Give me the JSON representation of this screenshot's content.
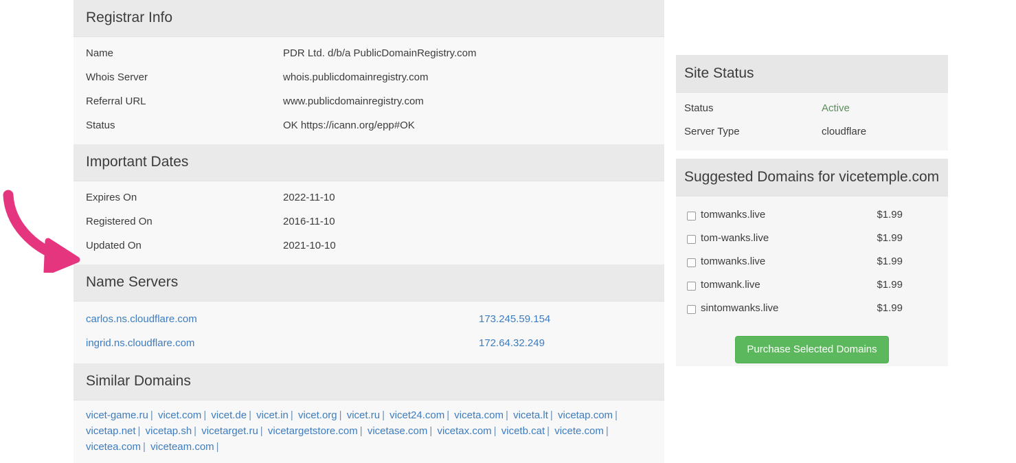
{
  "main": {
    "sections": [
      {
        "title": "Registrar Info",
        "type": "keyvalue",
        "rows": [
          {
            "key": "Name",
            "value": "PDR Ltd. d/b/a PublicDomainRegistry.com"
          },
          {
            "key": "Whois Server",
            "value": "whois.publicdomainregistry.com"
          },
          {
            "key": "Referral URL",
            "value": "www.publicdomainregistry.com"
          },
          {
            "key": "Status",
            "value": "OK https://icann.org/epp#OK"
          }
        ]
      },
      {
        "title": "Important Dates",
        "type": "keyvalue",
        "rows": [
          {
            "key": "Expires On",
            "value": "2022-11-10"
          },
          {
            "key": "Registered On",
            "value": "2016-11-10"
          },
          {
            "key": "Updated On",
            "value": "2021-10-10"
          }
        ]
      },
      {
        "title": "Name Servers",
        "type": "nameservers",
        "rows": [
          {
            "host": "carlos.ns.cloudflare.com",
            "ip": "173.245.59.154"
          },
          {
            "host": "ingrid.ns.cloudflare.com",
            "ip": "172.64.32.249"
          }
        ]
      },
      {
        "title": "Similar Domains",
        "type": "domainlist",
        "separator": "|",
        "domains": [
          "vicet-game.ru",
          "vicet.com",
          "vicet.de",
          "vicet.in",
          "vicet.org",
          "vicet.ru",
          "vicet24.com",
          "viceta.com",
          "viceta.lt",
          "vicetap.com",
          "vicetap.net",
          "vicetap.sh",
          "vicetarget.ru",
          "vicetargetstore.com",
          "vicetase.com",
          "vicetax.com",
          "vicetb.cat",
          "vicete.com",
          "vicetea.com",
          "viceteam.com"
        ]
      }
    ]
  },
  "sidebar": {
    "site_status": {
      "title": "Site Status",
      "rows": [
        {
          "key": "Status",
          "value": "Active",
          "style": "active"
        },
        {
          "key": "Server Type",
          "value": "cloudflare",
          "style": "plain"
        }
      ]
    },
    "suggested": {
      "title": "Suggested Domains for vicetemple.com",
      "items": [
        {
          "domain": "tomwanks.live",
          "price": "$1.99",
          "checked": false
        },
        {
          "domain": "tom-wanks.live",
          "price": "$1.99",
          "checked": false
        },
        {
          "domain": "tomwanks.live",
          "price": "$1.99",
          "checked": false
        },
        {
          "domain": "tomwank.live",
          "price": "$1.99",
          "checked": false
        },
        {
          "domain": "sintomwanks.live",
          "price": "$1.99",
          "checked": false
        }
      ],
      "purchase_label": "Purchase Selected Domains"
    }
  },
  "annotation": {
    "arrow_color": "#e6357f",
    "points_to": "Name Servers"
  },
  "colors": {
    "link": "#3d7cbf",
    "section_header_bg": "#eaeaea",
    "body_bg": "#f8f8f8",
    "active_green": "#5a8f5a",
    "button_green": "#5cb85c",
    "annotation_pink": "#e6357f"
  }
}
